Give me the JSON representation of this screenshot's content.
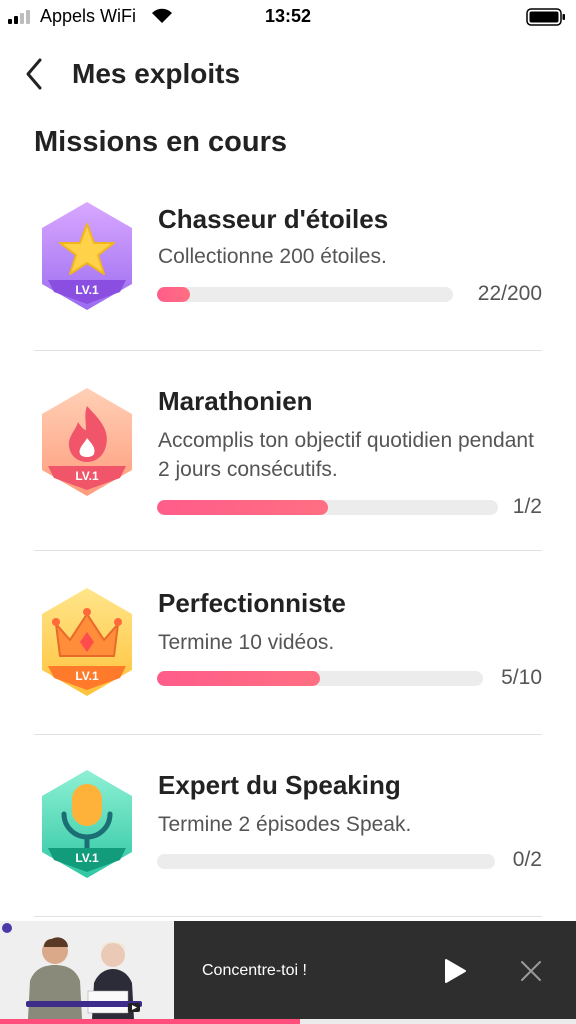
{
  "status_bar": {
    "carrier": "Appels WiFi",
    "time": "13:52"
  },
  "nav": {
    "title": "Mes exploits"
  },
  "section_title": "Missions en cours",
  "missions": [
    {
      "title": "Chasseur d'étoiles",
      "description": "Collectionne 200 étoiles.",
      "count": "22/200",
      "progress": 0.11,
      "level": "LV.1",
      "badge_icon": "star-icon",
      "badge_color": "#b98cf5"
    },
    {
      "title": "Marathonien",
      "description": "Accomplis ton objectif quotidien pendant 2 jours consécutifs.",
      "count": "1/2",
      "progress": 0.5,
      "level": "LV.1",
      "badge_icon": "flame-icon",
      "badge_color": "#ffad8a"
    },
    {
      "title": "Perfectionniste",
      "description": "Termine 10 vidéos.",
      "count": "5/10",
      "progress": 0.5,
      "level": "LV.1",
      "badge_icon": "crown-icon",
      "badge_color": "#ffd45a"
    },
    {
      "title": "Expert du Speaking",
      "description": "Termine 2 épisodes Speak.",
      "count": "0/2",
      "progress": 0,
      "level": "LV.1",
      "badge_icon": "microphone-icon",
      "badge_color": "#4cd6b6"
    }
  ],
  "player": {
    "text": "Concentre-toi !",
    "progress": 0.52
  },
  "colors": {
    "progress_fill": "#ff5c8a",
    "track": "#ececec"
  }
}
